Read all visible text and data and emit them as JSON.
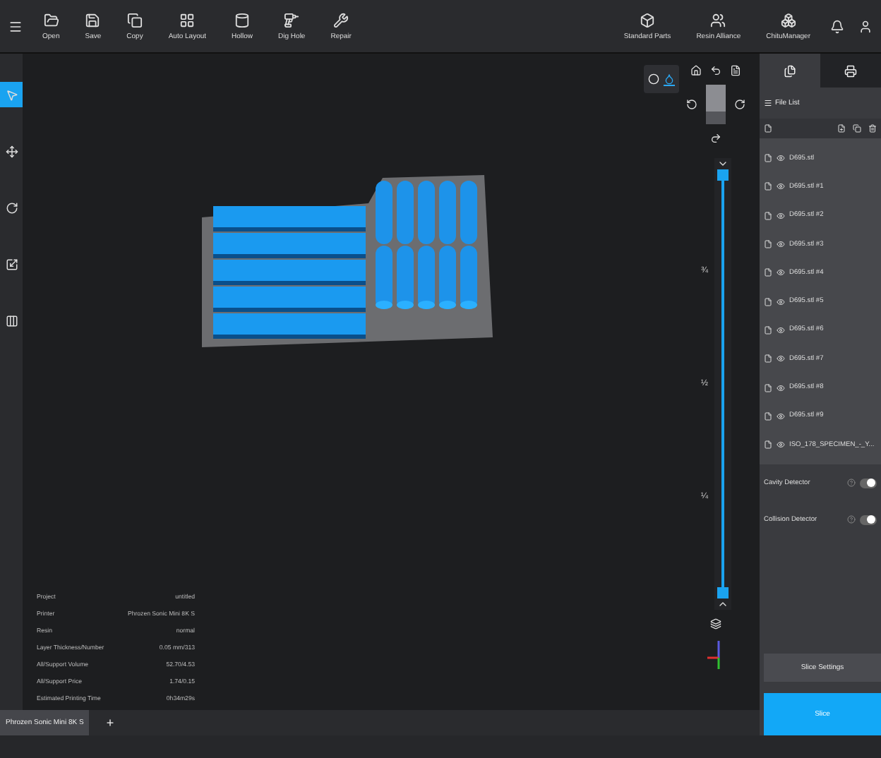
{
  "toolbar": {
    "tools": [
      {
        "label": "Open",
        "kind": "open"
      },
      {
        "label": "Save",
        "kind": "save"
      },
      {
        "label": "Copy",
        "kind": "copy"
      },
      {
        "label": "Auto Layout",
        "kind": "layout"
      },
      {
        "label": "Hollow",
        "kind": "hollow"
      },
      {
        "label": "Dig Hole",
        "kind": "dig"
      },
      {
        "label": "Repair",
        "kind": "repair"
      }
    ],
    "right_tools": [
      {
        "label": "Standard Parts",
        "kind": "parts"
      },
      {
        "label": "Resin Alliance",
        "kind": "resin"
      },
      {
        "label": "ChituManager",
        "kind": "chitu"
      }
    ]
  },
  "left_tools": [
    {
      "kind": "select",
      "selected": true
    },
    {
      "kind": "move",
      "selected": false
    },
    {
      "kind": "rotate",
      "selected": false
    },
    {
      "kind": "scale",
      "selected": false
    },
    {
      "kind": "support",
      "selected": false
    }
  ],
  "view_modes": [
    {
      "kind": "solid",
      "selected": false
    },
    {
      "kind": "xray",
      "selected": true
    }
  ],
  "layer_slider": {
    "level": 1,
    "marks": [
      "¾",
      "½",
      "¼"
    ]
  },
  "info": [
    {
      "label": "Project",
      "value": "untitled"
    },
    {
      "label": "Printer",
      "value": "Phrozen Sonic Mini 8K S"
    },
    {
      "label": "Resin",
      "value": "normal"
    },
    {
      "label": "Layer Thickness/Number",
      "value": "0.05 mm/313"
    },
    {
      "label": "All/Support Volume",
      "value": "52.70/4.53"
    },
    {
      "label": "All/Support Price",
      "value": "1.74/0.15"
    },
    {
      "label": "Estimated Printing Time",
      "value": "0h34m29s"
    }
  ],
  "printer_tabs": [
    {
      "label": "Phrozen Sonic Mini 8K S",
      "selected": true
    },
    {
      "label": "+",
      "selected": false
    }
  ],
  "panel_tabs": [
    {
      "kind": "files",
      "selected": true
    },
    {
      "kind": "printer",
      "selected": false
    }
  ],
  "file_list": {
    "title": "File List",
    "files": [
      "D695.stl",
      "D695.stl #1",
      "D695.stl #2",
      "D695.stl #3",
      "D695.stl #4",
      "D695.stl #5",
      "D695.stl #6",
      "D695.stl #7",
      "D695.stl #8",
      "D695.stl #9",
      "ISO_178_SPECIMEN_-_Y..."
    ]
  },
  "detectors": [
    {
      "label": "Cavity Detector",
      "on": true
    },
    {
      "label": "Collision Detector",
      "on": true
    }
  ],
  "buttons": {
    "settings": "Slice Settings",
    "slice": "Slice"
  }
}
